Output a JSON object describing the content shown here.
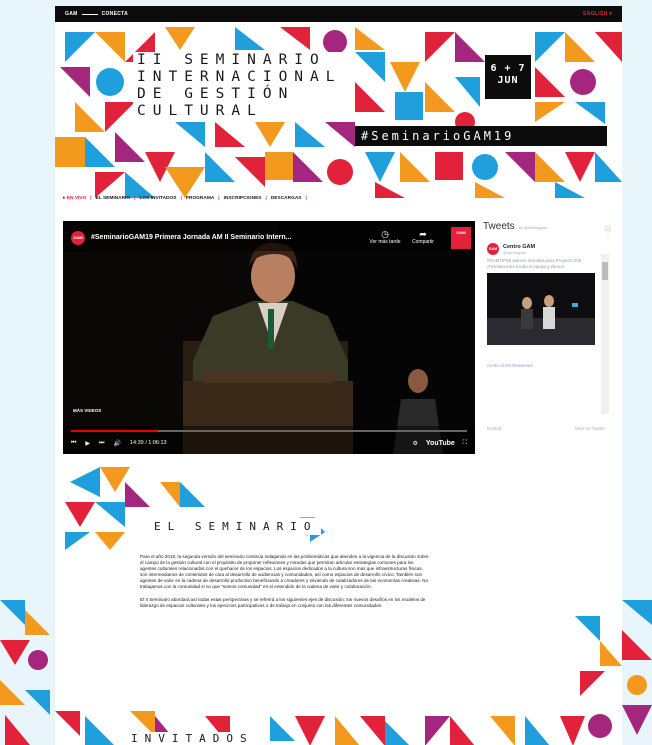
{
  "topbar": {
    "brand_left": "GAM",
    "brand_right": "CONECTA",
    "language": "ENGLISH"
  },
  "banner": {
    "title_lines": [
      "II SEMINARIO",
      "INTERNACIONAL",
      "DE GESTIÓN",
      "CULTURAL"
    ],
    "date_days": "6 + 7",
    "date_month": "JUN",
    "hashtag": "#SeminarioGAM19"
  },
  "nav": {
    "items": [
      "EN VIVO",
      "EL SEMINARIO",
      "LOS INVITADOS",
      "PROGRAMA",
      "INSCRIPCIONES",
      "DESCARGAS"
    ],
    "separator": "|"
  },
  "video": {
    "logo_text": "GAM",
    "title": "#SeminarioGAM19 Primera Jornada AM II Seminario Intern...",
    "watch_later": "Ver más tarde",
    "share": "Compartir",
    "sponsor_text": "GAM",
    "more_videos": "MÁS VIDEOS",
    "time": "14:39 / 1:06:13",
    "progress": 0.22,
    "youtube": "YouTube"
  },
  "tweets": {
    "title": "Tweets",
    "by": "by @centrogam",
    "user_name": "Centro GAM",
    "user_handle": "@centrogam",
    "text": "#GAMTIPS5 autores invitados para Proyecto 203. ¡Felicitaciones a todo el equipo y elenco!",
    "retweet": "Centro GAM Retweeted",
    "embed": "Embed",
    "view_on": "View on Twitter"
  },
  "seminario": {
    "heading": "EL SEMINARIO",
    "paragraphs": [
      "Para el año 2019, la segunda versión del seminario continúa indagando en las problemáticas que atienden a la vigencia de la discusión sobre el campo de la gestión cultural con el propósito de proponer reflexiones y miradas que permitan articular estrategias comunes para los agentes culturales relacionados con el quehacer de los espacios. Los espacios dedicados a la cultura son más que infraestructuras físicas, son intermediarios de contenidos de cara al desarrollo de audiencias y comunidades, así como espacios de desarrollo cívico. También son agentes de valor en la cadena de desarrollo productivo beneficiando a creadores y sirviendo de catalizadores de las economías creativas. No trabajamos con la comunidad si no que \"somos comunidad\" en el entendido de la cadena de valor y colaboración.",
      "El II Seminario abordará así todas estas perspectivas y se referirá a los siguientes ejes de discusión: los nuevos desafíos en los modelos de liderazgo de espacios culturales y los ejercicios participativos o de trabajo en conjunto con las diferentes comunidades."
    ]
  },
  "invitados": {
    "heading": "INVITADOS"
  },
  "colors": {
    "orange": "#f39a1e",
    "red": "#e2223b",
    "blue": "#1fa0dc",
    "purple": "#a5267f",
    "black": "#0c0c0c"
  }
}
